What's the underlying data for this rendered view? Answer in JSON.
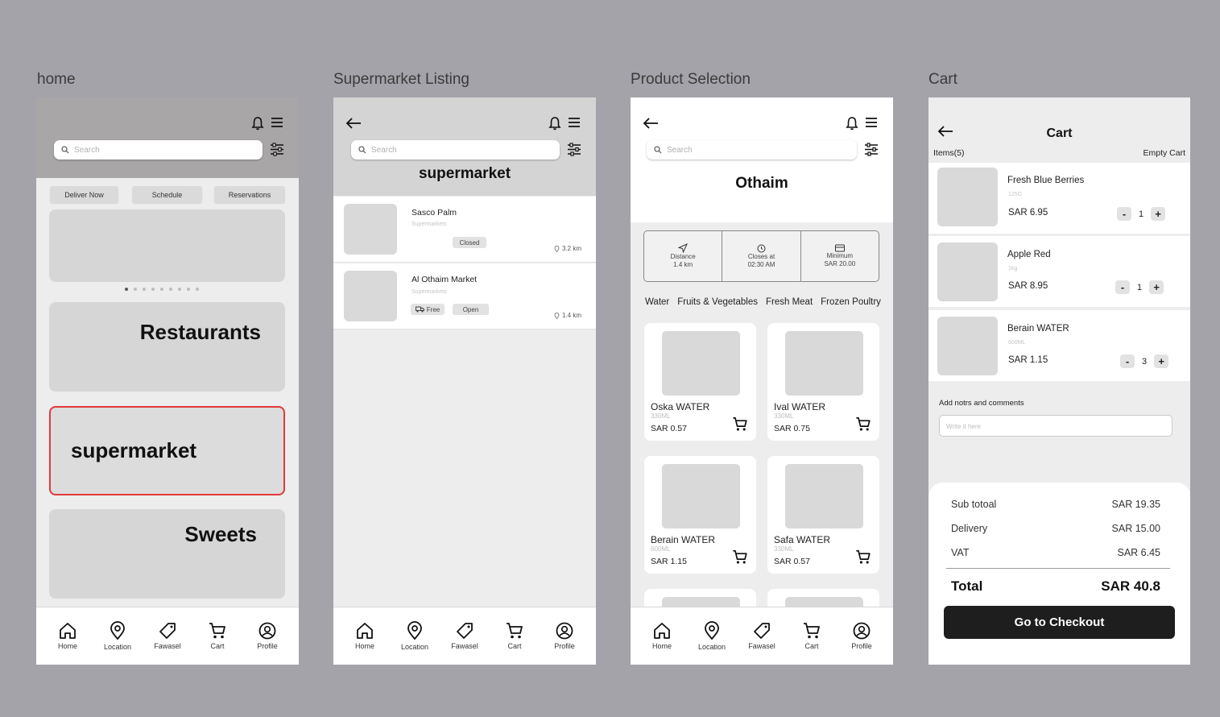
{
  "frames": {
    "home": "home",
    "listing": "Supermarket Listing",
    "product": "Product Selection",
    "cart": "Cart"
  },
  "search_placeholder": "Search",
  "nav": [
    "Home",
    "Location",
    "Fawasel",
    "Cart",
    "Profile"
  ],
  "home": {
    "pills": [
      "Deliver Now",
      "Schedule",
      "Reservations"
    ],
    "categories": [
      "Restaurants",
      "supermarket",
      "Sweets"
    ]
  },
  "listing": {
    "title": "supermarket",
    "stores": [
      {
        "name": "Sasco Palm",
        "type": "Supermarkets",
        "status": "Closed",
        "distance": "3.2 km"
      },
      {
        "name": "Al Othaim Market",
        "type": "Supermarkets",
        "delivery": "Free",
        "status": "Open",
        "distance": "1.4 km"
      }
    ]
  },
  "product": {
    "store": "Othaim",
    "info": [
      {
        "label": "Distance",
        "value": "1.4 km"
      },
      {
        "label": "Closes at",
        "value": "02:30 AM"
      },
      {
        "label": "Minimum",
        "value": "SAR 20.00"
      }
    ],
    "tabs": [
      "Water",
      "Fruits & Vegetables",
      "Fresh Meat",
      "Frozen Poultry"
    ],
    "items": [
      {
        "name": "Oska WATER",
        "size": "330ML",
        "price": "SAR 0.57"
      },
      {
        "name": "Ival WATER",
        "size": "330ML",
        "price": "SAR 0.75"
      },
      {
        "name": "Berain WATER",
        "size": "600ML",
        "price": "SAR 1.15"
      },
      {
        "name": "Safa WATER",
        "size": "330ML",
        "price": "SAR 0.57"
      }
    ]
  },
  "cart": {
    "title": "Cart",
    "items_count": "Items(5)",
    "empty": "Empty Cart",
    "items": [
      {
        "name": "Fresh Blue Berries",
        "size": "125G",
        "price": "SAR 6.95",
        "qty": "1"
      },
      {
        "name": "Apple Red",
        "size": "1kg",
        "price": "SAR 8.95",
        "qty": "1"
      },
      {
        "name": "Berain WATER",
        "size": "600ML",
        "price": "SAR 1.15",
        "qty": "3"
      }
    ],
    "notes_label": "Add notrs and comments",
    "notes_placeholder": "Write it here",
    "subtotal_label": "Sub totoal",
    "subtotal": "SAR 19.35",
    "delivery_label": "Delivery",
    "delivery": "SAR 15.00",
    "vat_label": "VAT",
    "vat": "SAR 6.45",
    "total_label": "Total",
    "total": "SAR 40.8",
    "checkout": "Go to Checkout"
  }
}
